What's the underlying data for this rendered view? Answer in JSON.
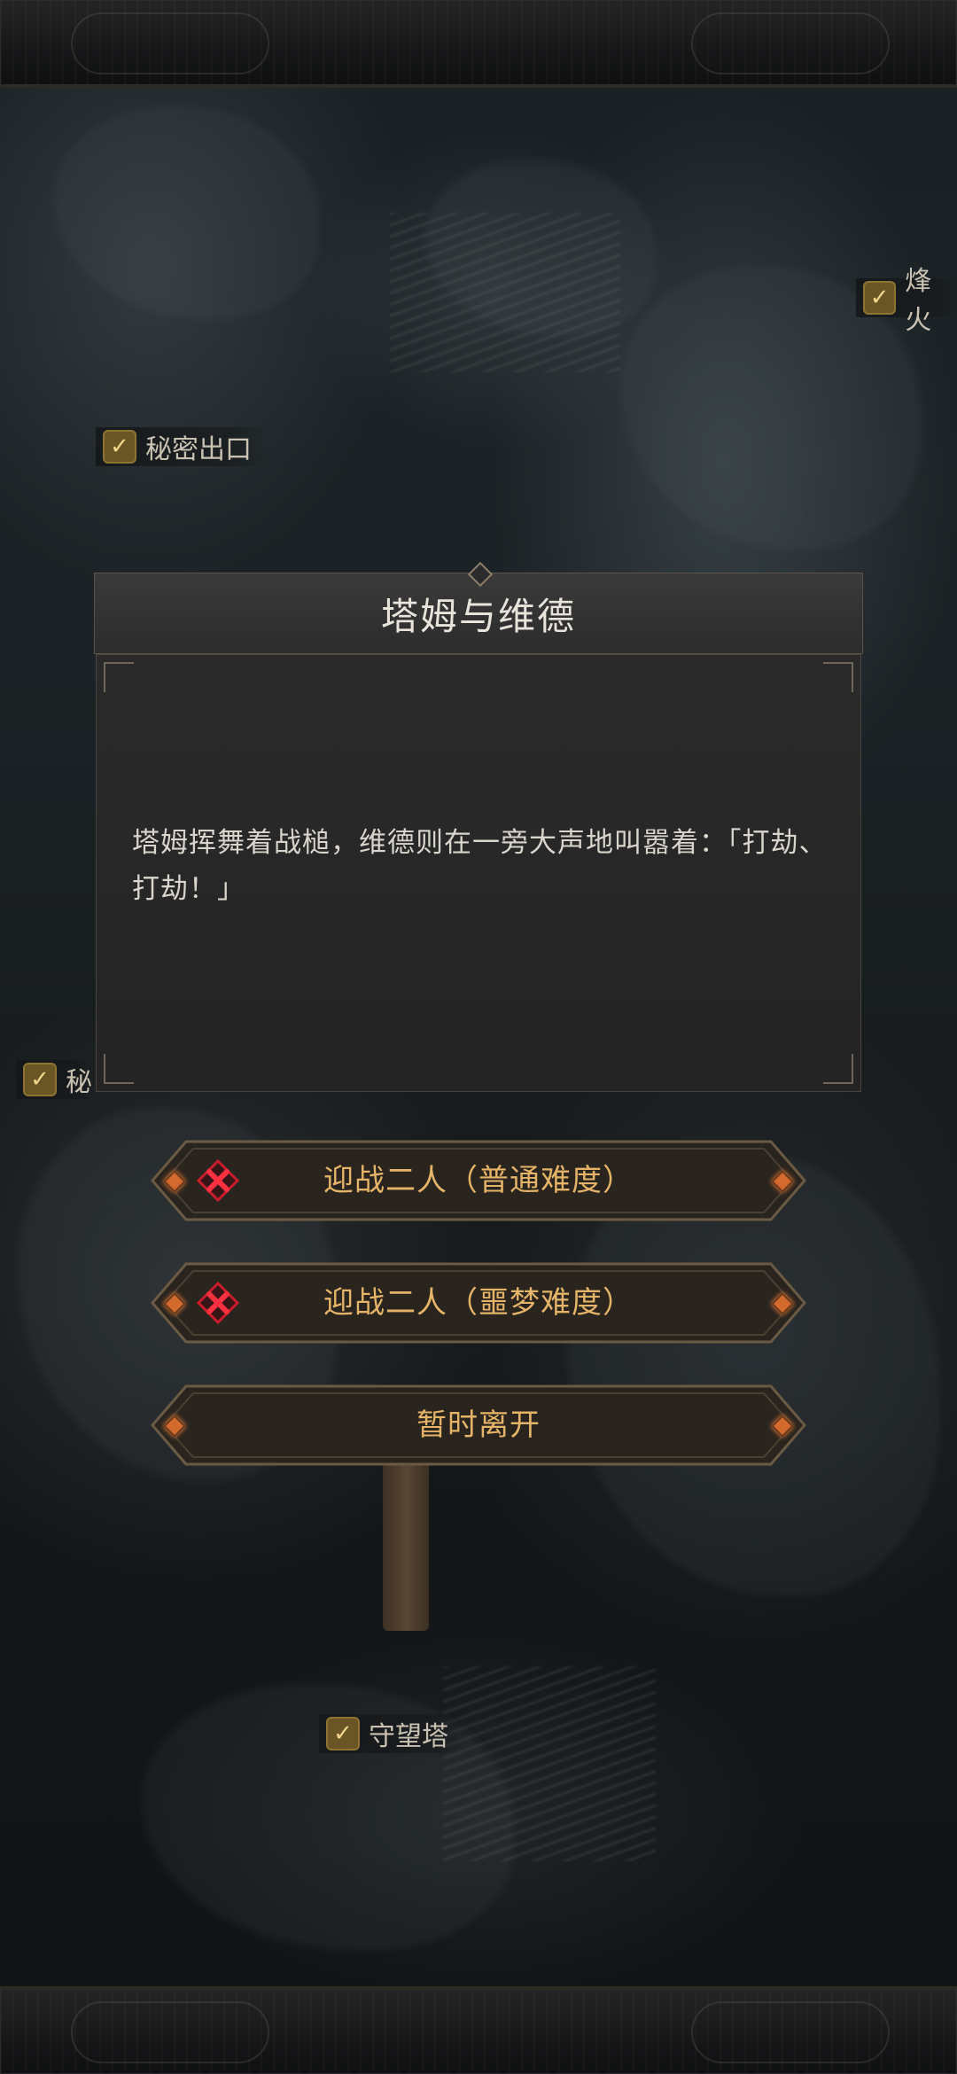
{
  "map": {
    "markers": [
      {
        "label": "秘密出口"
      },
      {
        "label": "烽火"
      },
      {
        "label": "秘"
      },
      {
        "label": "守望塔"
      }
    ]
  },
  "dialog": {
    "title": "塔姆与维德",
    "text": "塔姆挥舞着战槌，维德则在一旁大声地叫嚣着：「打劫、打劫！」"
  },
  "options": [
    {
      "label": "迎战二人（普通难度）",
      "locked": true
    },
    {
      "label": "迎战二人（噩梦难度）",
      "locked": true
    },
    {
      "label": "暂时离开",
      "locked": false
    }
  ],
  "colors": {
    "option_text": "#e5b468",
    "locked_icon": "#d11f2f",
    "check_marker": "#6a5524"
  },
  "icons": {
    "marker_check": "checkmark-icon",
    "locked_option": "red-x-icon",
    "option_gem": "orange-diamond-icon"
  }
}
